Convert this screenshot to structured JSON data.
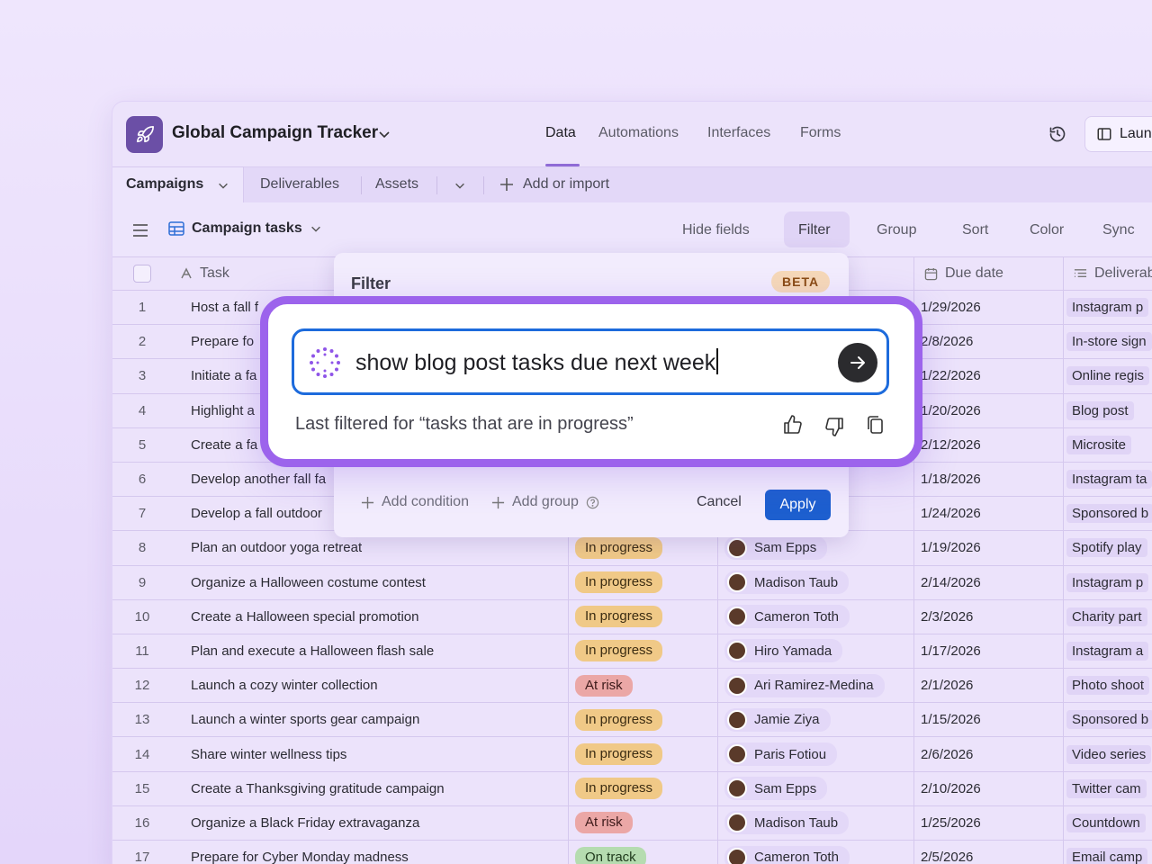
{
  "app": {
    "title": "Global Campaign Tracker",
    "nav_tabs": [
      "Data",
      "Automations",
      "Interfaces",
      "Forms"
    ],
    "active_nav": "Data",
    "launch_label": "Laun"
  },
  "tables": {
    "active": "Campaigns",
    "others": [
      "Deliverables",
      "Assets"
    ],
    "add_label": "Add or import"
  },
  "view": {
    "name": "Campaign tasks",
    "actions": [
      "Hide fields",
      "Filter",
      "Group",
      "Sort",
      "Color",
      "Sync"
    ]
  },
  "grid": {
    "headers": {
      "task": "Task",
      "due": "Due date",
      "deliverable": "Deliverab"
    },
    "rows": [
      {
        "n": "1",
        "task": "Host a fall f",
        "status": "",
        "status_kind": "",
        "owner": "",
        "due": "1/29/2026",
        "deliverable": "Instagram p"
      },
      {
        "n": "2",
        "task": "Prepare fo",
        "status": "",
        "status_kind": "",
        "owner": "",
        "due": "2/8/2026",
        "deliverable": "In-store sign"
      },
      {
        "n": "3",
        "task": "Initiate a fa",
        "status": "",
        "status_kind": "",
        "owner": "",
        "due": "1/22/2026",
        "deliverable": "Online regis"
      },
      {
        "n": "4",
        "task": "Highlight a",
        "status": "",
        "status_kind": "",
        "owner": "",
        "due": "1/20/2026",
        "deliverable": "Blog post"
      },
      {
        "n": "5",
        "task": "Create a fa",
        "status": "",
        "status_kind": "",
        "owner": "",
        "due": "2/12/2026",
        "deliverable": "Microsite"
      },
      {
        "n": "6",
        "task": "Develop another fall fa",
        "status": "",
        "status_kind": "",
        "owner": "",
        "due": "1/18/2026",
        "deliverable": "Instagram ta"
      },
      {
        "n": "7",
        "task": "Develop a fall outdoor",
        "status": "",
        "status_kind": "",
        "owner": "",
        "due": "1/24/2026",
        "deliverable": "Sponsored b"
      },
      {
        "n": "8",
        "task": "Plan an outdoor yoga retreat",
        "status": "In progress",
        "status_kind": "progress",
        "owner": "Sam Epps",
        "due": "1/19/2026",
        "deliverable": "Spotify play"
      },
      {
        "n": "9",
        "task": "Organize a Halloween costume contest",
        "status": "In progress",
        "status_kind": "progress",
        "owner": "Madison Taub",
        "due": "2/14/2026",
        "deliverable": "Instagram p"
      },
      {
        "n": "10",
        "task": "Create a Halloween special promotion",
        "status": "In progress",
        "status_kind": "progress",
        "owner": "Cameron Toth",
        "due": "2/3/2026",
        "deliverable": "Charity part"
      },
      {
        "n": "11",
        "task": "Plan and execute a Halloween flash sale",
        "status": "In progress",
        "status_kind": "progress",
        "owner": "Hiro Yamada",
        "due": "1/17/2026",
        "deliverable": "Instagram a"
      },
      {
        "n": "12",
        "task": "Launch a cozy winter collection",
        "status": "At risk",
        "status_kind": "risk",
        "owner": "Ari Ramirez-Medina",
        "due": "2/1/2026",
        "deliverable": "Photo shoot"
      },
      {
        "n": "13",
        "task": "Launch a winter sports gear campaign",
        "status": "In progress",
        "status_kind": "progress",
        "owner": "Jamie Ziya",
        "due": "1/15/2026",
        "deliverable": "Sponsored b"
      },
      {
        "n": "14",
        "task": "Share winter wellness tips",
        "status": "In progress",
        "status_kind": "progress",
        "owner": "Paris Fotiou",
        "due": "2/6/2026",
        "deliverable": "Video series"
      },
      {
        "n": "15",
        "task": "Create a Thanksgiving gratitude campaign",
        "status": "In progress",
        "status_kind": "progress",
        "owner": "Sam Epps",
        "due": "2/10/2026",
        "deliverable": "Twitter cam"
      },
      {
        "n": "16",
        "task": "Organize a Black Friday extravaganza",
        "status": "At risk",
        "status_kind": "risk",
        "owner": "Madison Taub",
        "due": "1/25/2026",
        "deliverable": "Countdown"
      },
      {
        "n": "17",
        "task": "Prepare for Cyber Monday madness",
        "status": "On track",
        "status_kind": "track",
        "owner": "Cameron Toth",
        "due": "2/5/2026",
        "deliverable": "Email camp"
      }
    ]
  },
  "filter_panel": {
    "title": "Filter",
    "badge": "BETA",
    "add_condition": "Add condition",
    "add_group": "Add group",
    "cancel": "Cancel",
    "apply": "Apply"
  },
  "ai_prompt": {
    "query": "show blog post tasks due next week",
    "last_filtered": "Last filtered for “tasks that are in progress”"
  },
  "colors": {
    "accent_purple": "#9c63ec",
    "input_border": "#1d6bdc",
    "apply_button": "#1d5fcf",
    "status_in_progress": "#f0c987",
    "status_at_risk": "#eba7a6",
    "status_on_track": "#b5dcb0"
  }
}
